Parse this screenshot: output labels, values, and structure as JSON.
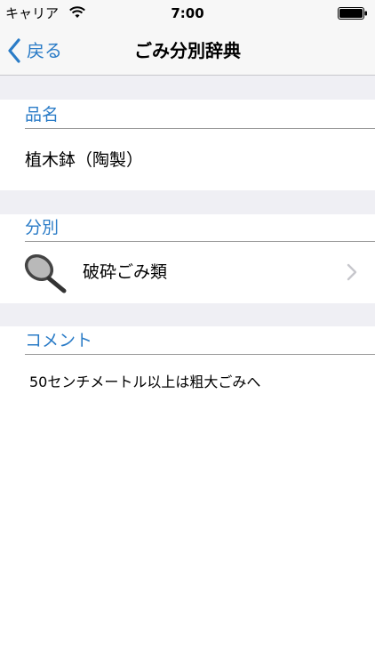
{
  "status_bar": {
    "carrier": "キャリア",
    "time": "7:00",
    "wifi_icon": "wifi-icon",
    "battery_icon": "battery-icon"
  },
  "nav": {
    "back_label": "戻る",
    "title": "ごみ分別辞典",
    "accent_color": "#2b7cc7"
  },
  "item_section": {
    "header": "品名",
    "value": "植木鉢（陶製）"
  },
  "category_section": {
    "header": "分別",
    "icon": "frying-pan-icon",
    "value": "破砕ごみ類"
  },
  "comment_section": {
    "header": "コメント",
    "text": "50センチメートル以上は粗大ごみへ"
  }
}
